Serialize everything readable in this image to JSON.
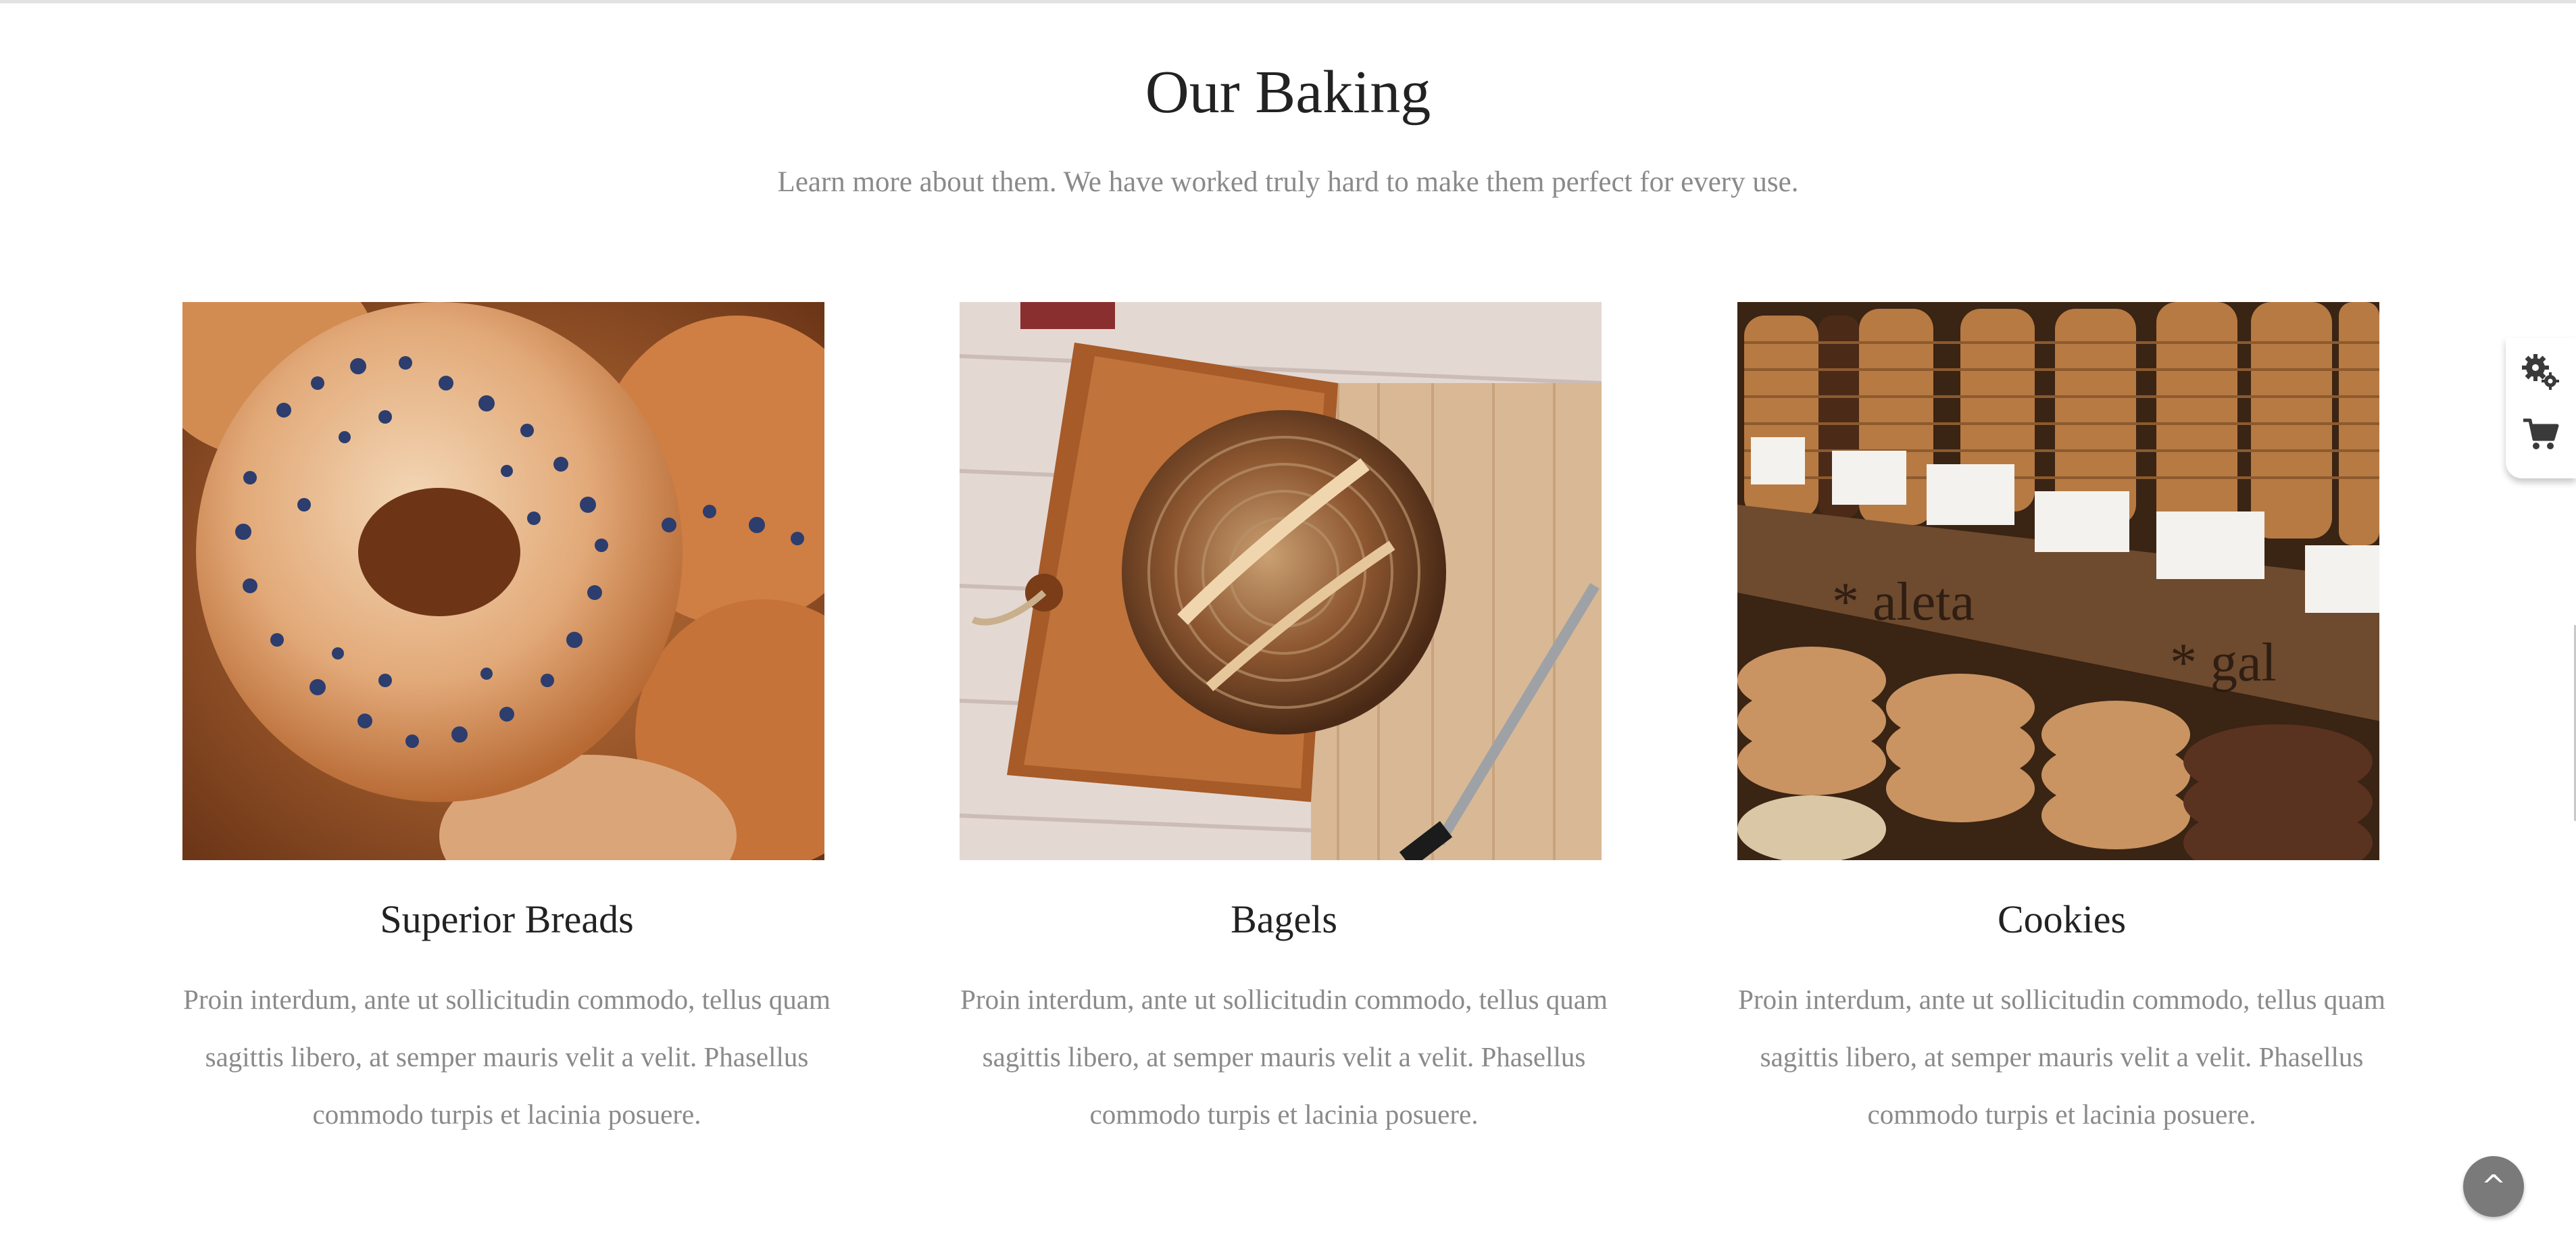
{
  "section": {
    "title": "Our Baking",
    "subtitle": "Learn more about them. We have worked truly hard to make them perfect for every use."
  },
  "cards": [
    {
      "title": "Superior Breads",
      "text": "Proin interdum, ante ut sollicitudin commodo, tellus quam sagittis libero, at semper mauris velit a velit. Phasellus commodo turpis et lacinia posuere.",
      "image": "poppy-seed-bagel-photo"
    },
    {
      "title": "Bagels",
      "text": "Proin interdum, ante ut sollicitudin commodo, tellus quam sagittis libero, at semper mauris velit a velit. Phasellus commodo turpis et lacinia posuere.",
      "image": "bread-loaf-on-board-photo"
    },
    {
      "title": "Cookies",
      "text": "Proin interdum, ante ut sollicitudin commodo, tellus quam sagittis libero, at semper mauris velit a velit. Phasellus commodo turpis et lacinia posuere.",
      "image": "cookie-stacks-display-photo"
    }
  ],
  "side_panel": {
    "icons": [
      "gears-icon",
      "shopping-cart-icon"
    ]
  },
  "back_to_top": {
    "label": "^"
  },
  "colors": {
    "title_text": "#222222",
    "body_text": "#8a8a8a",
    "back_to_top_bg": "#7a7a7a"
  }
}
